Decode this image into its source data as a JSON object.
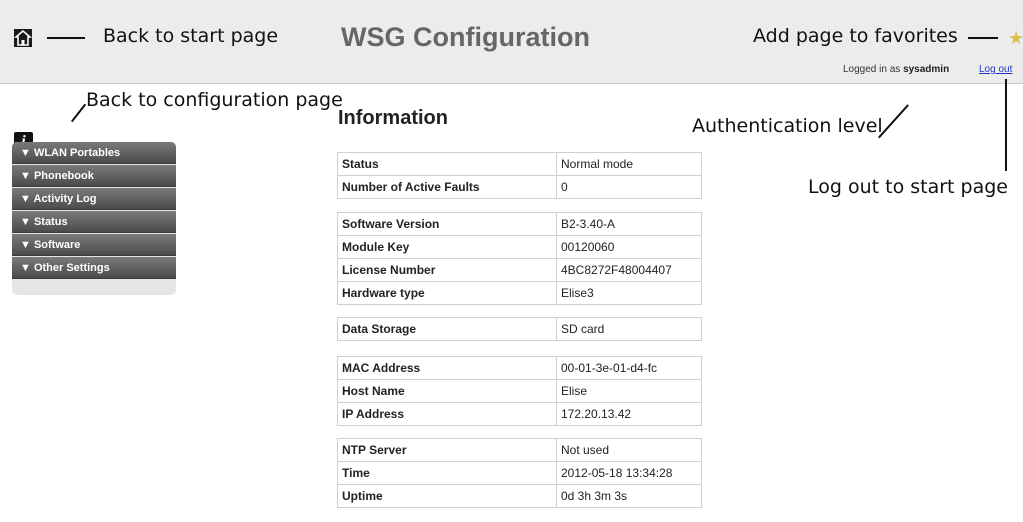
{
  "header": {
    "title": "WSG Configuration",
    "home_annotation": "Back to start page",
    "favorites_annotation": "Add page to favorites",
    "logged_in_prefix": "Logged in as",
    "username": "sysadmin",
    "logout_label": "Log out"
  },
  "annotations": {
    "config_page": "Back to configuration page",
    "auth_level": "Authentication level",
    "logout": "Log out to start page"
  },
  "sidebar": {
    "items": [
      {
        "label": "▼ WLAN Portables"
      },
      {
        "label": "▼ Phonebook"
      },
      {
        "label": "▼ Activity Log"
      },
      {
        "label": "▼ Status"
      },
      {
        "label": "▼ Software"
      },
      {
        "label": "▼ Other Settings"
      }
    ]
  },
  "main": {
    "title": "Information",
    "groups": [
      {
        "rows": [
          {
            "label": "Status",
            "value": "Normal mode"
          },
          {
            "label": "Number of Active Faults",
            "value": "0"
          }
        ]
      },
      {
        "rows": [
          {
            "label": "Software Version",
            "value": "B2-3.40-A"
          },
          {
            "label": "Module Key",
            "value": "00120060"
          },
          {
            "label": "License Number",
            "value": "4BC8272F48004407"
          },
          {
            "label": "Hardware type",
            "value": "Elise3"
          }
        ]
      },
      {
        "rows": [
          {
            "label": "Data Storage",
            "value": "SD card"
          }
        ]
      },
      {
        "rows": [
          {
            "label": "MAC Address",
            "value": "00-01-3e-01-d4-fc"
          },
          {
            "label": "Host Name",
            "value": "Elise"
          },
          {
            "label": "IP Address",
            "value": "172.20.13.42"
          }
        ]
      },
      {
        "rows": [
          {
            "label": "NTP Server",
            "value": "Not used"
          },
          {
            "label": "Time",
            "value": "2012-05-18 13:34:28"
          },
          {
            "label": "Uptime",
            "value": "0d 3h 3m 3s"
          }
        ]
      }
    ]
  },
  "icons": {
    "home": "home-icon",
    "info": "info-icon",
    "favorite": "star-icon"
  }
}
